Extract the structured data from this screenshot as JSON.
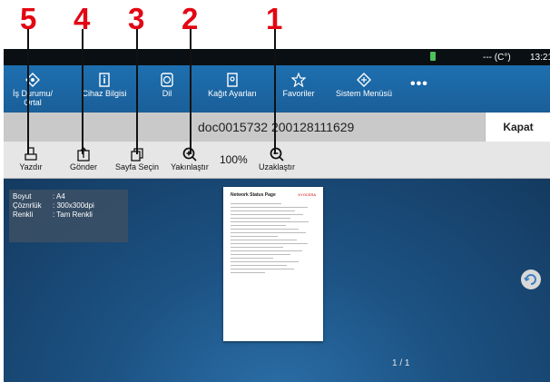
{
  "callouts": [
    "5",
    "4",
    "3",
    "2",
    "1"
  ],
  "status_bar": {
    "temp": "--- (C°)",
    "time": "13:21"
  },
  "tabs": [
    "İş Durumu/ Ortal",
    "Cihaz Bilgisi",
    "Dil",
    "Kağıt Ayarları",
    "Favoriler",
    "Sistem Menüsü"
  ],
  "more_label": "•••",
  "document": {
    "title": "doc0015732 200128111629",
    "close_label": "Kapat"
  },
  "toolbar": {
    "print_label": "Yazdır",
    "send_label": "Gönder",
    "page_select_label": "Sayfa Seçin",
    "zoom_in_label": "Yakınlaştır",
    "zoom_value": "100%",
    "zoom_out_label": "Uzaklaştır"
  },
  "info": {
    "size_key": "Boyut",
    "size_val": ": A4",
    "res_key": "Çöznrlük",
    "res_val": ": 300x300dpi",
    "color_key": "Renkli",
    "color_val": ": Tam Renkli"
  },
  "preview": {
    "page_title": "Network Status Page",
    "brand": "KYOCERA"
  },
  "pager": "1 / 1",
  "colors": {
    "accent": "#e30613",
    "tabbar": "#1e6fb0"
  }
}
